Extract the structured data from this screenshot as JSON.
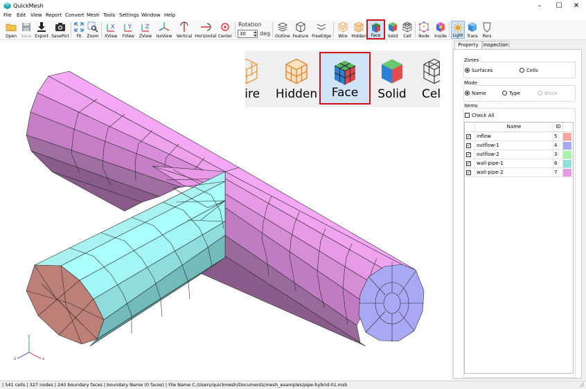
{
  "app": {
    "title": "QuickMesh"
  },
  "window_controls": {
    "minimize": "–",
    "maximize": "☐",
    "close": "✕"
  },
  "menu": [
    "File",
    "Edit",
    "View",
    "Report",
    "Convert",
    "Mesh",
    "Tools",
    "Settings",
    "Window",
    "Help"
  ],
  "toolbar": {
    "open": "Open",
    "save": "Save",
    "export": "Export",
    "savepict": "SavePict",
    "fit": "Fit",
    "zoom": "Zoom",
    "xview": "XView",
    "yview": "YView",
    "zview": "ZView",
    "isoview": "IsoView",
    "vertical": "Vertical",
    "horizontal": "Horizontal",
    "center": "Center",
    "rotation_label": "Rotation",
    "rotation_value": "30",
    "rotation_unit": "deg",
    "outline": "Outline",
    "feature": "Feature",
    "freeedge": "FreeEdge",
    "wire": "Wire",
    "hidden": "Hidden",
    "face": "Face",
    "solid": "Solid",
    "cell": "Cell",
    "node": "Node",
    "inside": "Inside",
    "light": "Light",
    "trans": "Trans",
    "pers": "Pers"
  },
  "zoom_inset": {
    "wire": "Wire",
    "hidden": "Hidden",
    "face": "Face",
    "solid": "Solid",
    "cell": "Cel"
  },
  "axes": {
    "x": "x",
    "y": "y",
    "z": "z"
  },
  "panel": {
    "tabs": [
      "Property",
      "Inspection"
    ],
    "zones_title": "Zones",
    "zones_surfaces": "Surfaces",
    "zones_cells": "Cells",
    "mode_title": "Mode",
    "mode_name": "Name",
    "mode_type": "Type",
    "mode_block": "Block",
    "items_title": "Items",
    "check_all": "Check All",
    "col_name": "Name",
    "col_id": "ID",
    "check_mark": "✓",
    "items": [
      {
        "name": "inflow",
        "id": "5",
        "color": "#f4a6a0"
      },
      {
        "name": "outflow-1",
        "id": "4",
        "color": "#a8a8f2"
      },
      {
        "name": "outflow-2",
        "id": "3",
        "color": "#a8f2a6"
      },
      {
        "name": "wall-pipe-1",
        "id": "6",
        "color": "#8ee0dc"
      },
      {
        "name": "wall-pipe-2",
        "id": "7",
        "color": "#e69ae6"
      }
    ]
  },
  "status": "| 541 cells | 327 nodes | 240 boundary faces |  boundary Name  (0 faces) | File Name C:/Users/quickmesh/Documents/mesh_examples/pipe-hybrid-01.msh",
  "colors": {
    "pink_light": "#f5a8f5",
    "pink_dark": "#8a5c8c",
    "cyan_light": "#aaffff",
    "cyan_dark": "#5e9c9c",
    "red_face": "#bd8078",
    "blue_face": "#a8a8f5",
    "selection": "#d2121b"
  }
}
